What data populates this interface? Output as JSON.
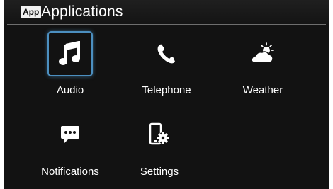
{
  "header": {
    "badge": "App",
    "title": "Applications"
  },
  "apps": [
    {
      "label": "Audio",
      "icon": "music-note-icon",
      "selected": true
    },
    {
      "label": "Telephone",
      "icon": "phone-icon",
      "selected": false
    },
    {
      "label": "Weather",
      "icon": "weather-icon",
      "selected": false
    },
    {
      "label": "Notifications",
      "icon": "chat-bubble-icon",
      "selected": false
    },
    {
      "label": "Settings",
      "icon": "device-gear-icon",
      "selected": false
    }
  ],
  "colors": {
    "background": "#121212",
    "selection_border": "#4c8fc0",
    "text": "#ffffff"
  }
}
